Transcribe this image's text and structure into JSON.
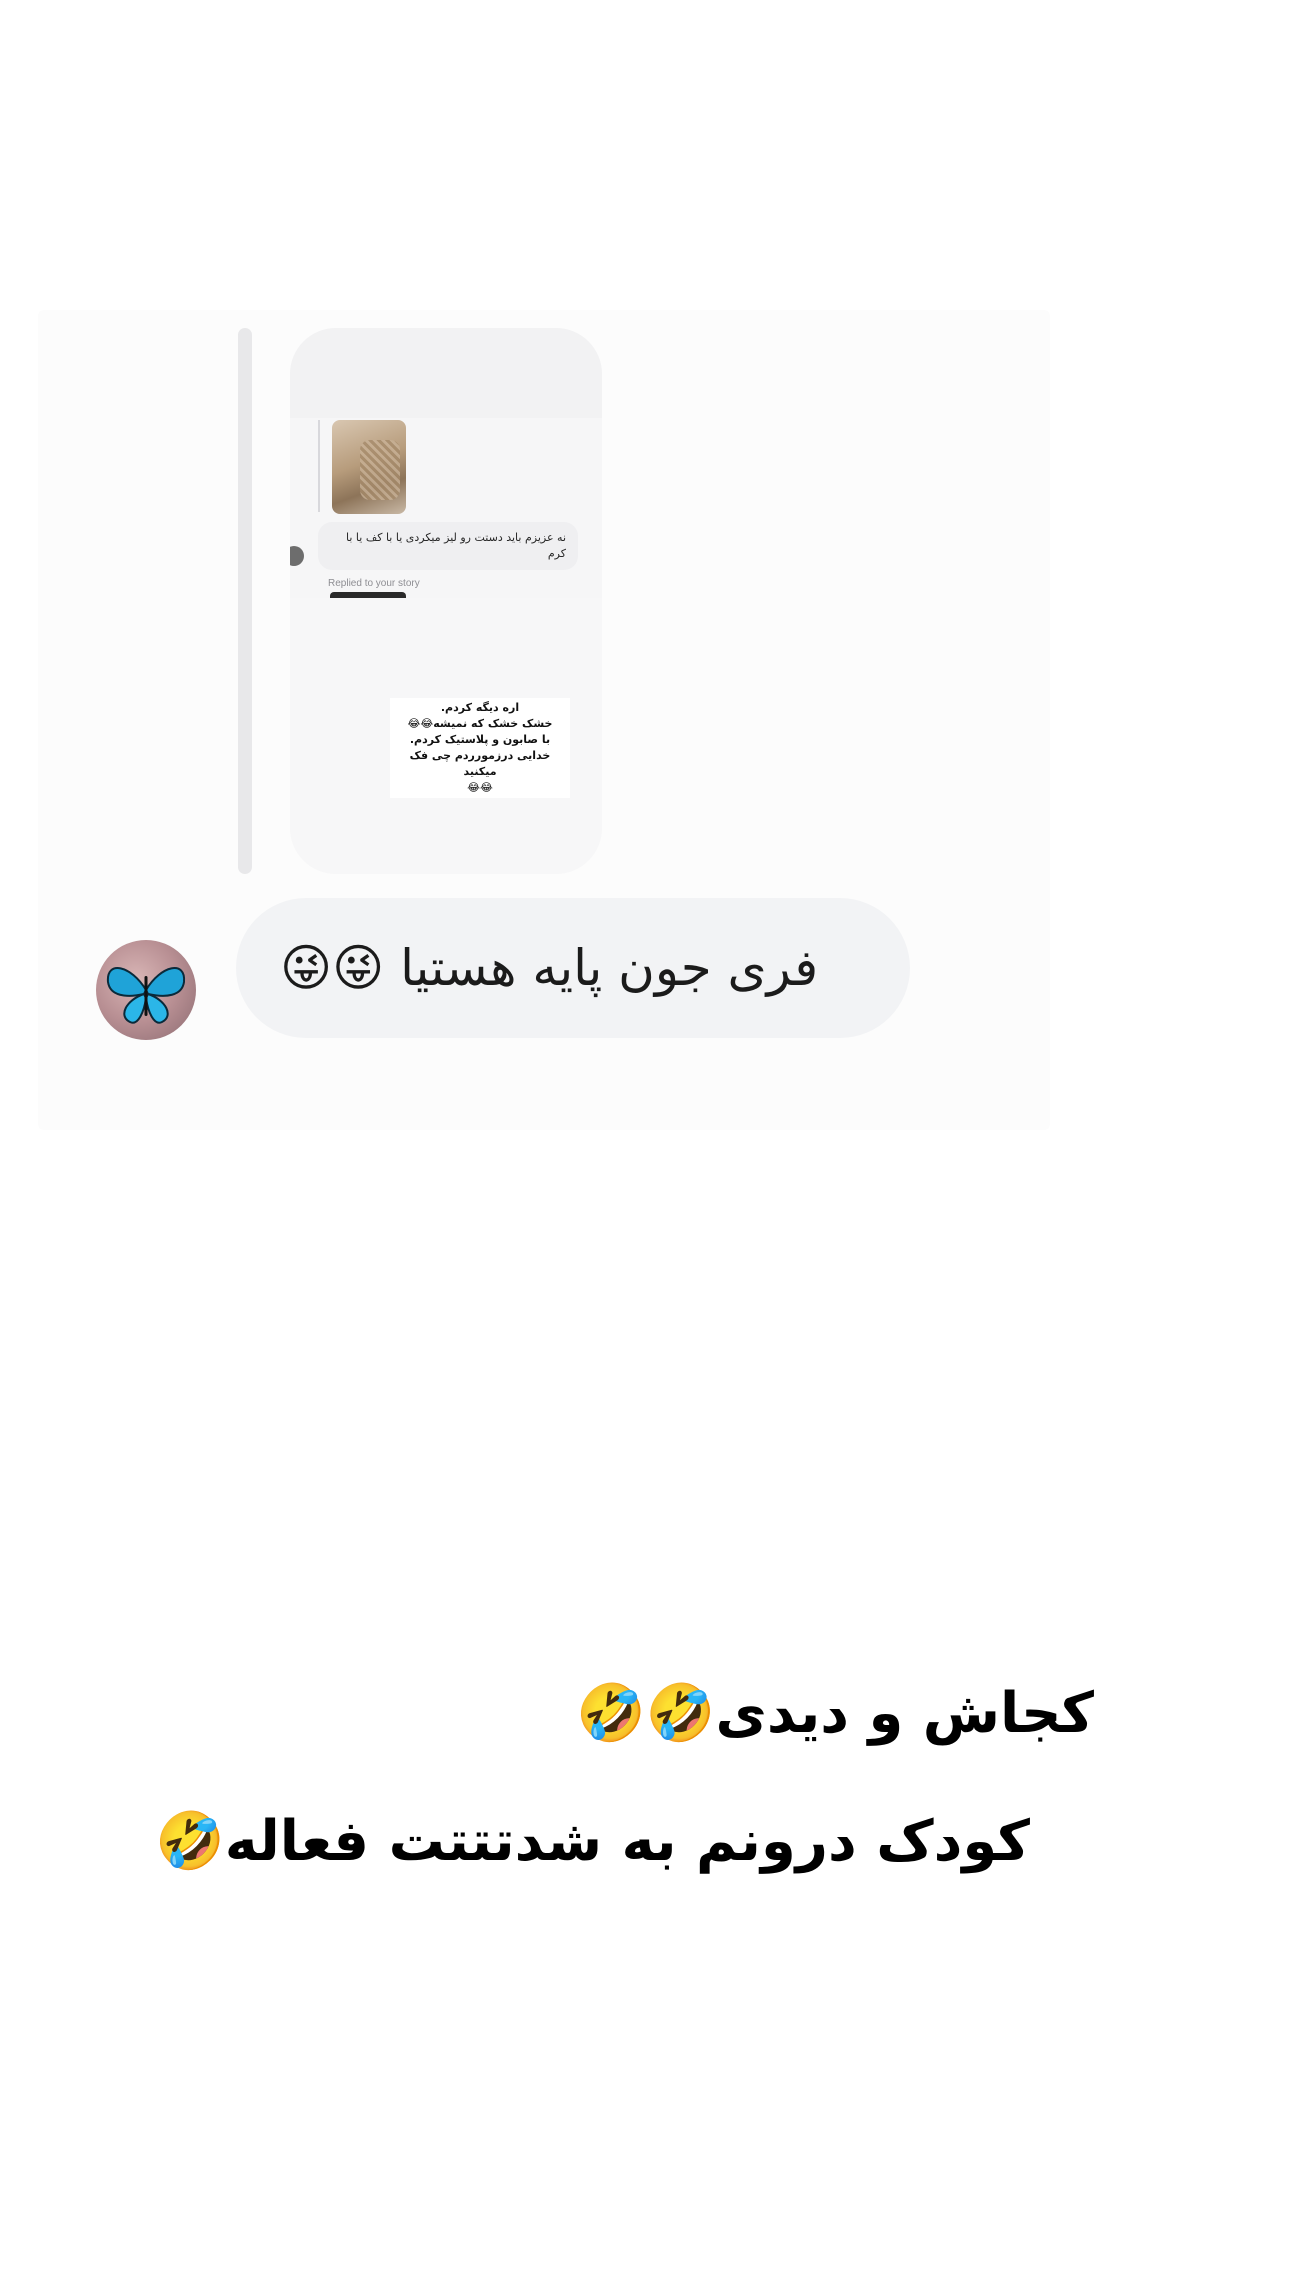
{
  "screenshot": {
    "inner_message": "نه عزیزم باید دستت رو لیز میکردی یا با کف یا با کرم",
    "replied_label": "Replied to your story",
    "story_text": "اره دیگه کردم.\nخشک خشک که نمیشه😂😂\nبا صابون و پلاستیک کردم.\nخدایی درزمورردم چی فک میکنید\n😂😂",
    "main_message": "فری جون پایه هستیا 😜😜"
  },
  "captions": {
    "line_1": "کجاش و دیدی🤣🤣",
    "line_2": "کودک درونم به شدتتتت فعاله🤣"
  },
  "colors": {
    "bubble": "#f2f3f5",
    "butterfly": "#1fa3d8"
  }
}
